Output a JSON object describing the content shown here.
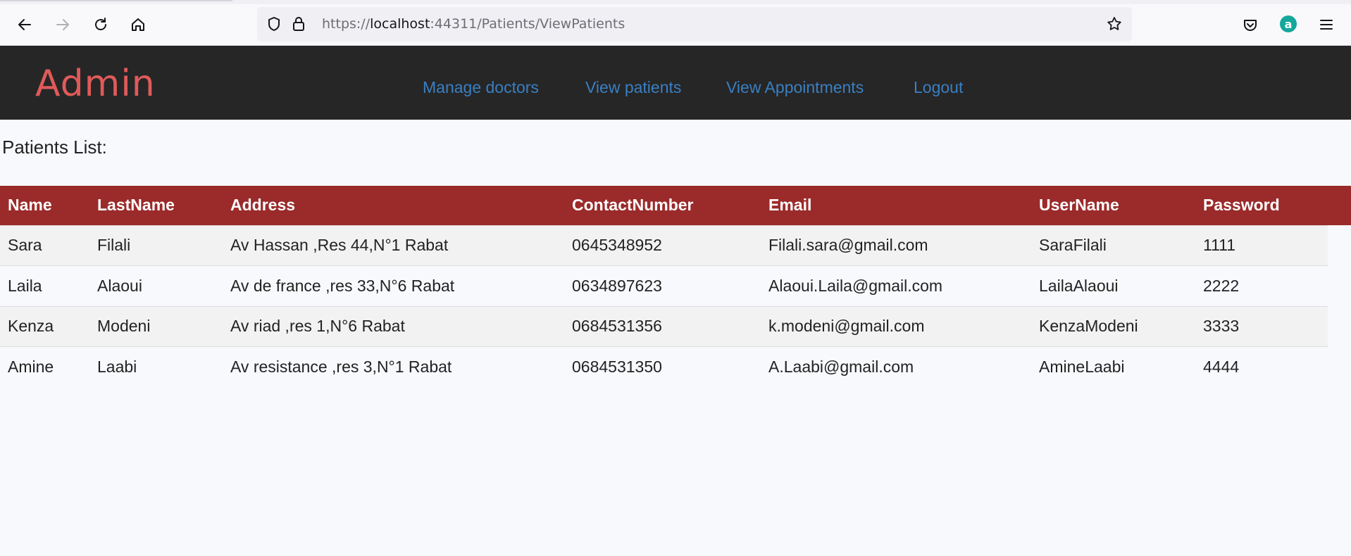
{
  "browser": {
    "url_prefix": "https://",
    "url_host": "localhost",
    "url_path": ":44311/Patients/ViewPatients",
    "account_initial": "a"
  },
  "navbar": {
    "brand": "Admin",
    "links": [
      "Manage doctors",
      "View patients",
      "View Appointments",
      "Logout"
    ],
    "brand_color": "#e05a5a",
    "link_color": "#3a7fc2",
    "background": "#262626"
  },
  "page": {
    "heading": "Patients List:"
  },
  "table": {
    "header_color": "#9b2a2a",
    "columns": [
      "Name",
      "LastName",
      "Address",
      "ContactNumber",
      "Email",
      "UserName",
      "Password"
    ],
    "rows": [
      [
        "Sara",
        "Filali",
        "Av Hassan ,Res 44,N°1 Rabat",
        "0645348952",
        "Filali.sara@gmail.com",
        "SaraFilali",
        "1111"
      ],
      [
        "Laila",
        "Alaoui",
        "Av de france ,res 33,N°6 Rabat",
        "0634897623",
        "Alaoui.Laila@gmail.com",
        "LailaAlaoui",
        "2222"
      ],
      [
        "Kenza",
        "Modeni",
        "Av riad ,res 1,N°6 Rabat",
        "0684531356",
        "k.modeni@gmail.com",
        "KenzaModeni",
        "3333"
      ],
      [
        "Amine",
        "Laabi",
        "Av resistance ,res 3,N°1 Rabat",
        "0684531350",
        "A.Laabi@gmail.com",
        "AmineLaabi",
        "4444"
      ]
    ]
  }
}
